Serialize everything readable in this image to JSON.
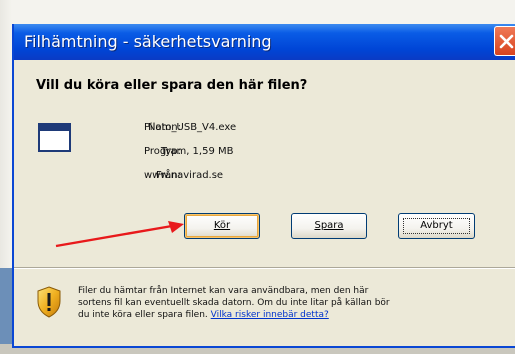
{
  "dialog": {
    "title": "Filhämtning - säkerhetsvarning",
    "question": "Vill du köra eller spara den här filen?",
    "file": {
      "name_label": "Namn:",
      "name_value": "Piloto_USB_V4.exe",
      "type_label": "Typ:",
      "type_value": "Program, 1,59 MB",
      "from_label": "Från:",
      "from_value": "www.navirad.se"
    },
    "buttons": {
      "run": "Kör",
      "save": "Spara",
      "cancel": "Avbryt"
    },
    "warning": {
      "line1": "Filer du hämtar från Internet kan vara användbara, men den här",
      "line2": "sortens fil kan eventuellt skada datorn. Om du inte litar på källan bör",
      "line3_text": "du inte köra eller spara filen.",
      "link": "Vilka risker innebär detta?"
    }
  },
  "colors": {
    "titlebar": "#0045d6",
    "dialog_background": "#ece9d8",
    "annotation_arrow": "#e8191b",
    "link": "#0033cc"
  },
  "icons": {
    "close": "close-icon",
    "application": "application-icon",
    "warning": "shield-warning-icon",
    "annotation": "red-arrow-icon"
  }
}
